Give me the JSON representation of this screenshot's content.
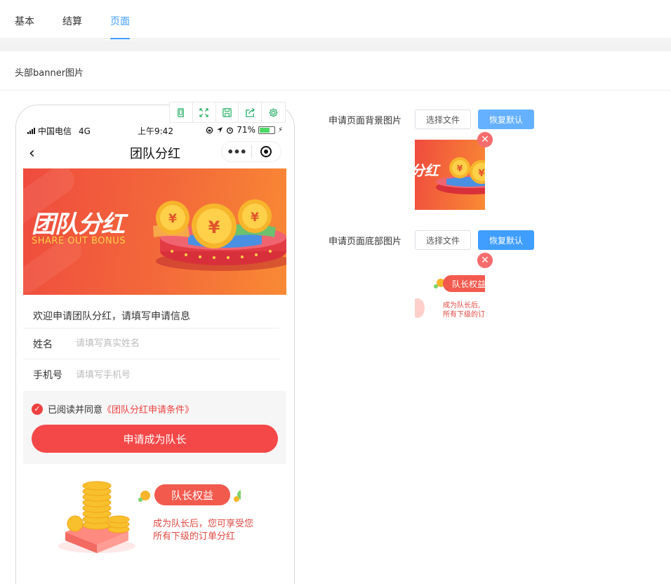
{
  "tabs": [
    {
      "label": "基本",
      "active": false
    },
    {
      "label": "结算",
      "active": false
    },
    {
      "label": "页面",
      "active": true
    }
  ],
  "section_title": "头部banner图片",
  "toolbar_icons": [
    "phone-icon",
    "fullscreen-icon",
    "save-icon",
    "share-icon",
    "gear-icon"
  ],
  "phone": {
    "status": {
      "carrier": "中国电信",
      "network": "4G",
      "time": "上午9:42",
      "battery": "71%",
      "battery_level": 0.71
    },
    "nav": {
      "back": "‹",
      "title": "团队分红",
      "more": "•••"
    },
    "banner": {
      "title": "团队分红",
      "subtitle": "SHARE OUT BONUS"
    },
    "form": {
      "intro": "欢迎申请团队分红，请填写申请信息",
      "name_label": "姓名",
      "name_placeholder": "请填写真实姓名",
      "phone_label": "手机号",
      "phone_placeholder": "请填写手机号"
    },
    "agree": {
      "text": "已阅读并同意",
      "link": "《团队分红申请条件》",
      "checked": true
    },
    "apply_button": "申请成为队长",
    "rights": {
      "badge": "队长权益",
      "line1": "成为队长后，您可享受您",
      "line2": "所有下级的订单分红"
    }
  },
  "config": {
    "bg": {
      "label": "申请页面背景图片",
      "choose": "选择文件",
      "reset": "恢复默认",
      "thumb_text": "分红"
    },
    "bottom": {
      "label": "申请页面底部图片",
      "choose": "选择文件",
      "reset": "恢复默认",
      "thumb_badge": "队长权益",
      "thumb_line1": "成为队长后,",
      "thumb_line2": "所有下级的订"
    }
  },
  "colors": {
    "accent": "#409eff",
    "reset_light": "#66b1ff",
    "reset": "#409eff",
    "danger": "#f56c6c",
    "brand_red": "#f44848"
  }
}
